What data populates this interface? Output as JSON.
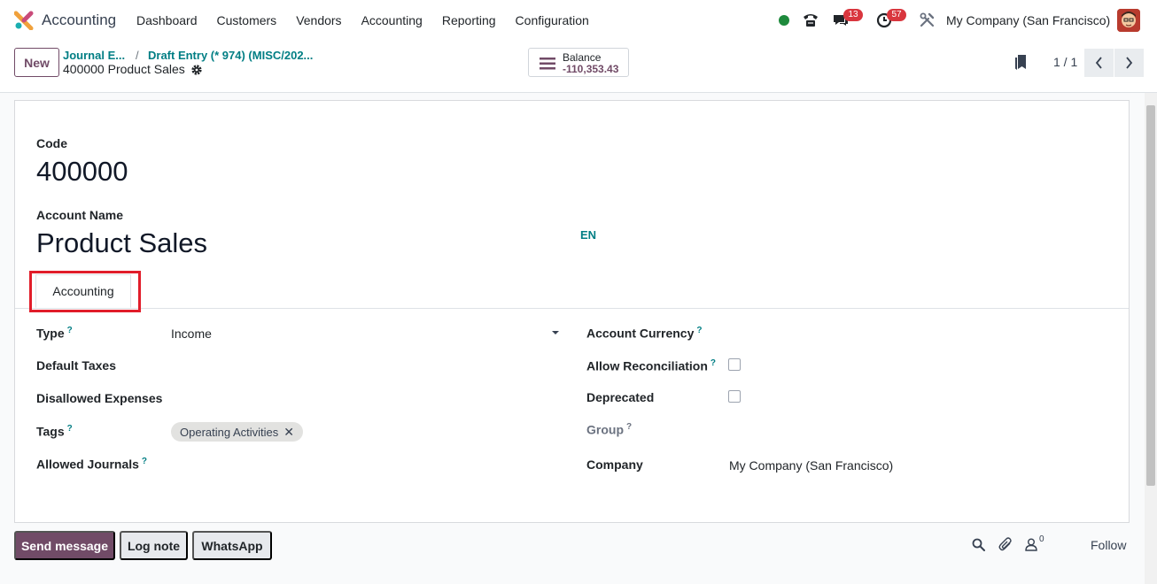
{
  "navbar": {
    "app_name": "Accounting",
    "menu": [
      "Dashboard",
      "Customers",
      "Vendors",
      "Accounting",
      "Reporting",
      "Configuration"
    ],
    "messages_badge": "13",
    "activities_badge": "57",
    "company": "My Company (San Francisco)"
  },
  "control_panel": {
    "new_label": "New",
    "breadcrumb": [
      "Journal E...",
      "Draft Entry (* 974) (MISC/202..."
    ],
    "breadcrumb_sep": "/",
    "record_title": "400000 Product Sales",
    "balance_label": "Balance",
    "balance_value": "-110,353.43",
    "pager": "1 / 1"
  },
  "form": {
    "code_label": "Code",
    "code_value": "400000",
    "name_label": "Account Name",
    "name_value": "Product Sales",
    "lang": "EN",
    "tab_label": "Accounting",
    "help_mark": "?",
    "left": {
      "type_label": "Type",
      "type_value": "Income",
      "default_taxes_label": "Default Taxes",
      "disallowed_label": "Disallowed Expenses",
      "tags_label": "Tags",
      "tag_value": "Operating Activities",
      "allowed_journals_label": "Allowed Journals"
    },
    "right": {
      "currency_label": "Account Currency",
      "reconcile_label": "Allow Reconciliation",
      "deprecated_label": "Deprecated",
      "group_label": "Group",
      "company_label": "Company",
      "company_value": "My Company (San Francisco)"
    }
  },
  "chatter": {
    "send_label": "Send message",
    "log_label": "Log note",
    "whatsapp_label": "WhatsApp",
    "followers_count": "0",
    "follow_label": "Follow"
  },
  "colors": {
    "brand": "#714b67",
    "link": "#017e84",
    "highlight": "#e11d2a",
    "online": "#1e8a3c",
    "badge": "#d9363e"
  }
}
